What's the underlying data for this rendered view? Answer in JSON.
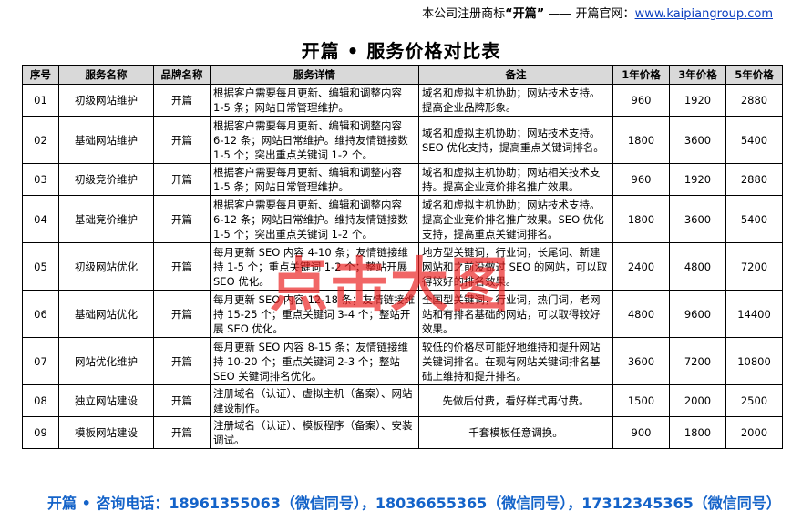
{
  "header": {
    "prefix": "本公司注册商标",
    "brand": "“开篇”",
    "dash": "——",
    "site_label": "开篇官网：",
    "site_url": "www.kaipiangroup.com"
  },
  "title": "开篇 • 服务价格对比表",
  "table": {
    "columns": [
      "序号",
      "服务名称",
      "品牌名称",
      "服务详情",
      "备注",
      "1年价格",
      "3年价格",
      "5年价格"
    ],
    "rows": [
      {
        "no": "01",
        "service": "初级网站维护",
        "brand": "开篇",
        "detail": "根据客户需要每月更新、编辑和调整内容 1-5 条；网站日常管理维护。",
        "note": "域名和虚拟主机协助；网站技术支持。提高企业品牌形象。",
        "p1": "960",
        "p3": "1920",
        "p5": "2880"
      },
      {
        "no": "02",
        "service": "基础网站维护",
        "brand": "开篇",
        "detail": "根据客户需要每月更新、编辑和调整内容 6-12 条；网站日常维护。维持友情链接数 1-5 个；突出重点关键词 1-2 个。",
        "note": "域名和虚拟主机协助；网站技术支持。SEO 优化支持，提高重点关键词排名。",
        "p1": "1800",
        "p3": "3600",
        "p5": "5400"
      },
      {
        "no": "03",
        "service": "初级竞价维护",
        "brand": "开篇",
        "detail": "根据客户需要每月更新、编辑和调整内容 1-5 条；网站日常管理维护。",
        "note": "域名和虚拟主机协助；网站相关技术支持。提高企业竞价排名推广效果。",
        "p1": "960",
        "p3": "1920",
        "p5": "2880"
      },
      {
        "no": "04",
        "service": "基础竞价维护",
        "brand": "开篇",
        "detail": "根据客户需要每月更新、编辑和调整内容 6-12 条；网站日常维护。维持友情链接数 1-5 个；突出重点关键词 1-2 个。",
        "note": "域名和虚拟主机协助；网站技术支持。提高企业竞价排名推广效果。SEO 优化支持，提高重点关键词排名。",
        "p1": "1800",
        "p3": "3600",
        "p5": "5400"
      },
      {
        "no": "05",
        "service": "初级网站优化",
        "brand": "开篇",
        "detail": "每月更新 SEO 内容 4-10 条；友情链接维持 1-5 个；重点关键词 1-2 个；整站开展 SEO 优化。",
        "note": "地方型关键词，行业词，长尾词、新建网站和之前没做过 SEO 的网站，可以取得较好的排名效果。",
        "p1": "2400",
        "p3": "4800",
        "p5": "7200"
      },
      {
        "no": "06",
        "service": "基础网站优化",
        "brand": "开篇",
        "detail": "每月更新 SEO 内容 12-18 条；友情链接维持 15-25 个；重点关键词 3-4 个；整站开展 SEO 优化。",
        "note": "全国型关键词，行业词，热门词，老网站和有排名基础的网站，可以取得较好效果。",
        "p1": "4800",
        "p3": "9600",
        "p5": "14400"
      },
      {
        "no": "07",
        "service": "网站优化维护",
        "brand": "开篇",
        "detail": "每月更新 SEO 内容 8-15 条；友情链接维持 10-20 个；重点关键词 2-3 个；整站 SEO 关键词排名优化。",
        "note": "较低的价格尽可能好地维持和提升网站关键词排名。在现有网站关键词排名基础上维持和提升排名。",
        "p1": "3600",
        "p3": "7200",
        "p5": "10800"
      },
      {
        "no": "08",
        "service": "独立网站建设",
        "brand": "开篇",
        "detail": "注册域名（认证）、虚拟主机（备案）、网站建设制作。",
        "note": "先做后付费，看好样式再付费。",
        "note_center": true,
        "p1": "1500",
        "p3": "2000",
        "p5": "2500"
      },
      {
        "no": "09",
        "service": "模板网站建设",
        "brand": "开篇",
        "detail": "注册域名（认证）、模板程序（备案）、安装调试。",
        "note": "千套模板任意调换。",
        "note_center": true,
        "p1": "900",
        "p3": "1800",
        "p5": "2000"
      }
    ]
  },
  "watermark": "点击大图",
  "footer": "开篇 • 咨询电话：18961355063（微信同号），18036655365（微信同号），17312345365（微信同号）",
  "colors": {
    "header_bg": "#d9d9d9",
    "footer_text": "#1463c9",
    "link": "#0b3fbf",
    "watermark": "#eb1e1e"
  }
}
